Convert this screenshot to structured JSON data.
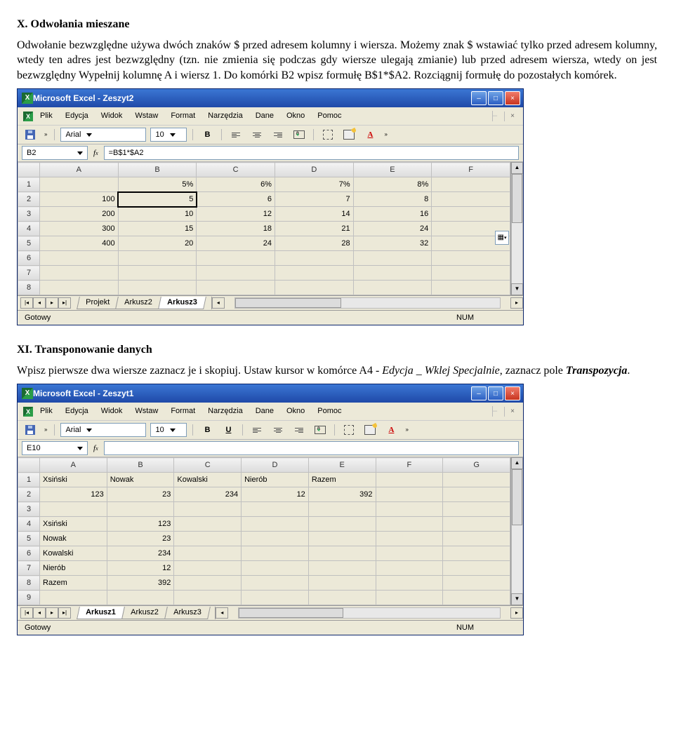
{
  "section_x": {
    "title": "X. Odwołania mieszane",
    "paragraph": "Odwołanie bezwzględne używa dwóch znaków $ przed adresem kolumny i wiersza. Możemy znak $ wstawiać tylko przed adresem kolumny, wtedy ten adres jest bezwzględny (tzn. nie zmienia się podczas gdy wiersze ulegają zmianie) lub przed adresem wiersza, wtedy on jest bezwzględny Wypełnij kolumnę A i wiersz 1. Do komórki B2 wpisz formułę B$1*$A2. Rozciągnij formułę do pozostałych komórek."
  },
  "section_xi": {
    "title": "XI. Transponowanie danych",
    "p1_pre": "Wpisz pierwsze dwa wiersze zaznacz je i skopiuj. Ustaw kursor w komórce A4 - ",
    "p1_mid": "Edycja _ Wklej Specjalnie",
    "p1_post": ", zaznacz pole ",
    "p1_last": "Transpozycja",
    "p1_end": "."
  },
  "menus": [
    "Plik",
    "Edycja",
    "Widok",
    "Wstaw",
    "Format",
    "Narzędzia",
    "Dane",
    "Okno",
    "Pomoc"
  ],
  "toolbar": {
    "font": "Arial",
    "size": "10",
    "bold": "B",
    "underline": "U",
    "chev": "»"
  },
  "win1": {
    "title": "Microsoft Excel - Zeszyt2",
    "cellref": "B2",
    "formula": "=B$1*$A2",
    "cols": [
      "A",
      "B",
      "C",
      "D",
      "E",
      "F"
    ],
    "rows": [
      {
        "n": "1",
        "c": [
          "",
          "5%",
          "6%",
          "7%",
          "8%",
          ""
        ]
      },
      {
        "n": "2",
        "c": [
          "100",
          "5",
          "6",
          "7",
          "8",
          ""
        ]
      },
      {
        "n": "3",
        "c": [
          "200",
          "10",
          "12",
          "14",
          "16",
          ""
        ]
      },
      {
        "n": "4",
        "c": [
          "300",
          "15",
          "18",
          "21",
          "24",
          ""
        ]
      },
      {
        "n": "5",
        "c": [
          "400",
          "20",
          "24",
          "28",
          "32",
          ""
        ]
      },
      {
        "n": "6",
        "c": [
          "",
          "",
          "",
          "",
          "",
          ""
        ]
      },
      {
        "n": "7",
        "c": [
          "",
          "",
          "",
          "",
          "",
          ""
        ]
      },
      {
        "n": "8",
        "c": [
          "",
          "",
          "",
          "",
          "",
          ""
        ]
      }
    ],
    "tabs": [
      "Projekt",
      "Arkusz2",
      "Arkusz3"
    ],
    "active_tab": 2,
    "status": "Gotowy",
    "num": "NUM"
  },
  "win2": {
    "title": "Microsoft Excel - Zeszyt1",
    "cellref": "E10",
    "formula": "",
    "cols": [
      "A",
      "B",
      "C",
      "D",
      "E",
      "F",
      "G"
    ],
    "rows": [
      {
        "n": "1",
        "c": [
          "Xsiński",
          "Nowak",
          "Kowalski",
          "Nierób",
          "Razem",
          "",
          ""
        ]
      },
      {
        "n": "2",
        "c": [
          "123",
          "23",
          "234",
          "12",
          "392",
          "",
          ""
        ]
      },
      {
        "n": "3",
        "c": [
          "",
          "",
          "",
          "",
          "",
          "",
          ""
        ]
      },
      {
        "n": "4",
        "c": [
          "Xsiński",
          "123",
          "",
          "",
          "",
          "",
          ""
        ]
      },
      {
        "n": "5",
        "c": [
          "Nowak",
          "23",
          "",
          "",
          "",
          "",
          ""
        ]
      },
      {
        "n": "6",
        "c": [
          "Kowalski",
          "234",
          "",
          "",
          "",
          "",
          ""
        ]
      },
      {
        "n": "7",
        "c": [
          "Nierób",
          "12",
          "",
          "",
          "",
          "",
          ""
        ]
      },
      {
        "n": "8",
        "c": [
          "Razem",
          "392",
          "",
          "",
          "",
          "",
          ""
        ]
      },
      {
        "n": "9",
        "c": [
          "",
          "",
          "",
          "",
          "",
          "",
          ""
        ]
      }
    ],
    "tabs": [
      "Arkusz1",
      "Arkusz2",
      "Arkusz3"
    ],
    "active_tab": 0,
    "status": "Gotowy",
    "num": "NUM"
  }
}
